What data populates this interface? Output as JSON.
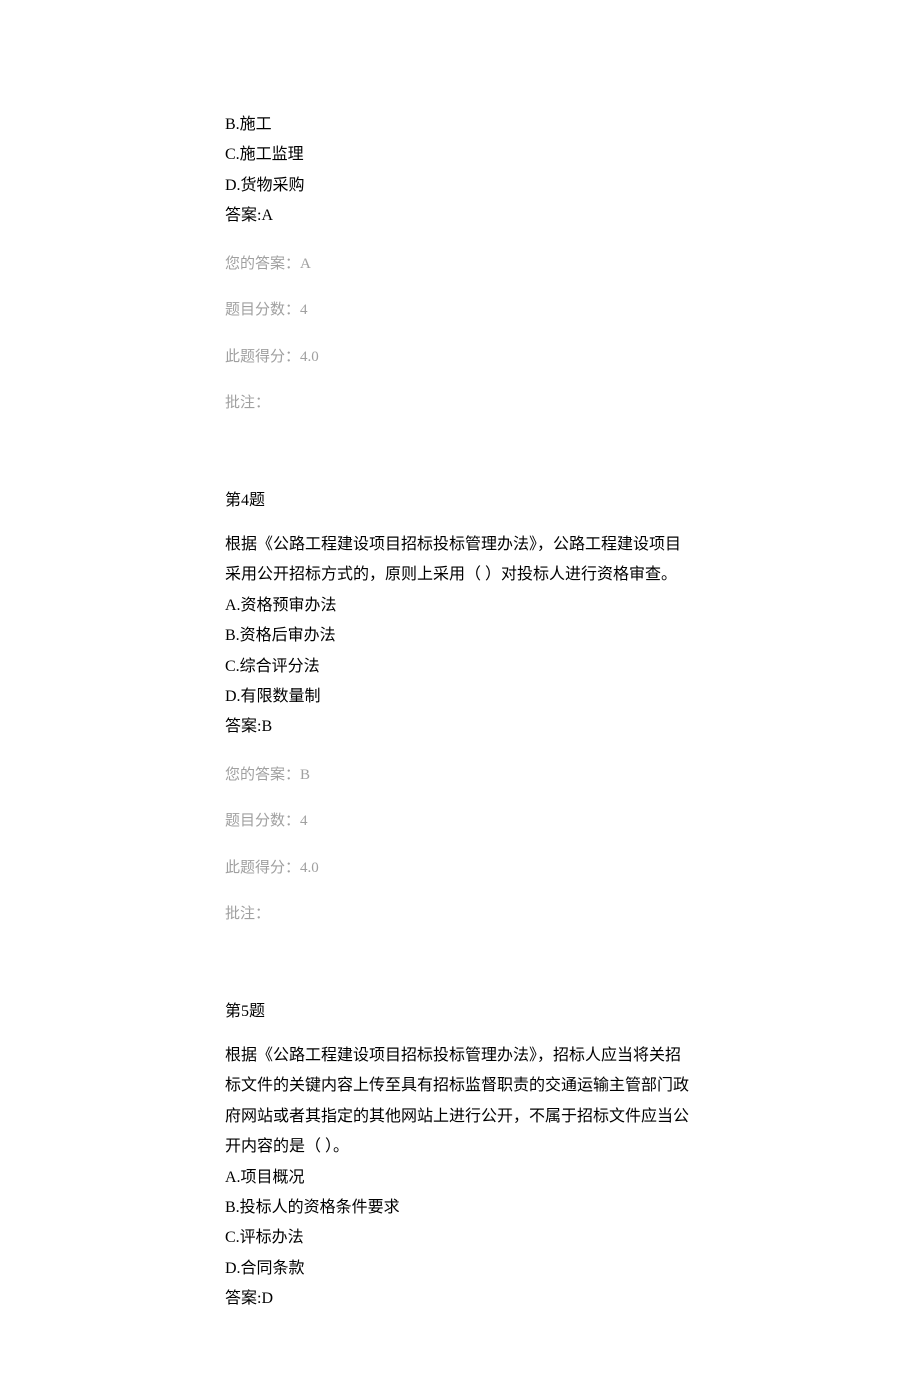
{
  "q3": {
    "opt_b": "B.施工",
    "opt_c": "C.施工监理",
    "opt_d": "D.货物采购",
    "answer_label": "答案:A",
    "your_answer": "您的答案：A",
    "full_score": "题目分数：4",
    "got_score": "此题得分：4.0",
    "comment": "批注："
  },
  "q4": {
    "num": "第4题",
    "stem": "根据《公路工程建设项目招标投标管理办法》，公路工程建设项目采用公开招标方式的，原则上采用（ ）对投标人进行资格审查。",
    "opt_a": "A.资格预审办法",
    "opt_b": "B.资格后审办法",
    "opt_c": "C.综合评分法",
    "opt_d": "D.有限数量制",
    "answer_label": "答案:B",
    "your_answer": "您的答案：B",
    "full_score": "题目分数：4",
    "got_score": "此题得分：4.0",
    "comment": "批注："
  },
  "q5": {
    "num": "第5题",
    "stem": "根据《公路工程建设项目招标投标管理办法》，招标人应当将关招标文件的关键内容上传至具有招标监督职责的交通运输主管部门政府网站或者其指定的其他网站上进行公开，不属于招标文件应当公开内容的是（ ）。",
    "opt_a": "A.项目概况",
    "opt_b": "B.投标人的资格条件要求",
    "opt_c": "C.评标办法",
    "opt_d": "D.合同条款",
    "answer_label": "答案:D"
  }
}
